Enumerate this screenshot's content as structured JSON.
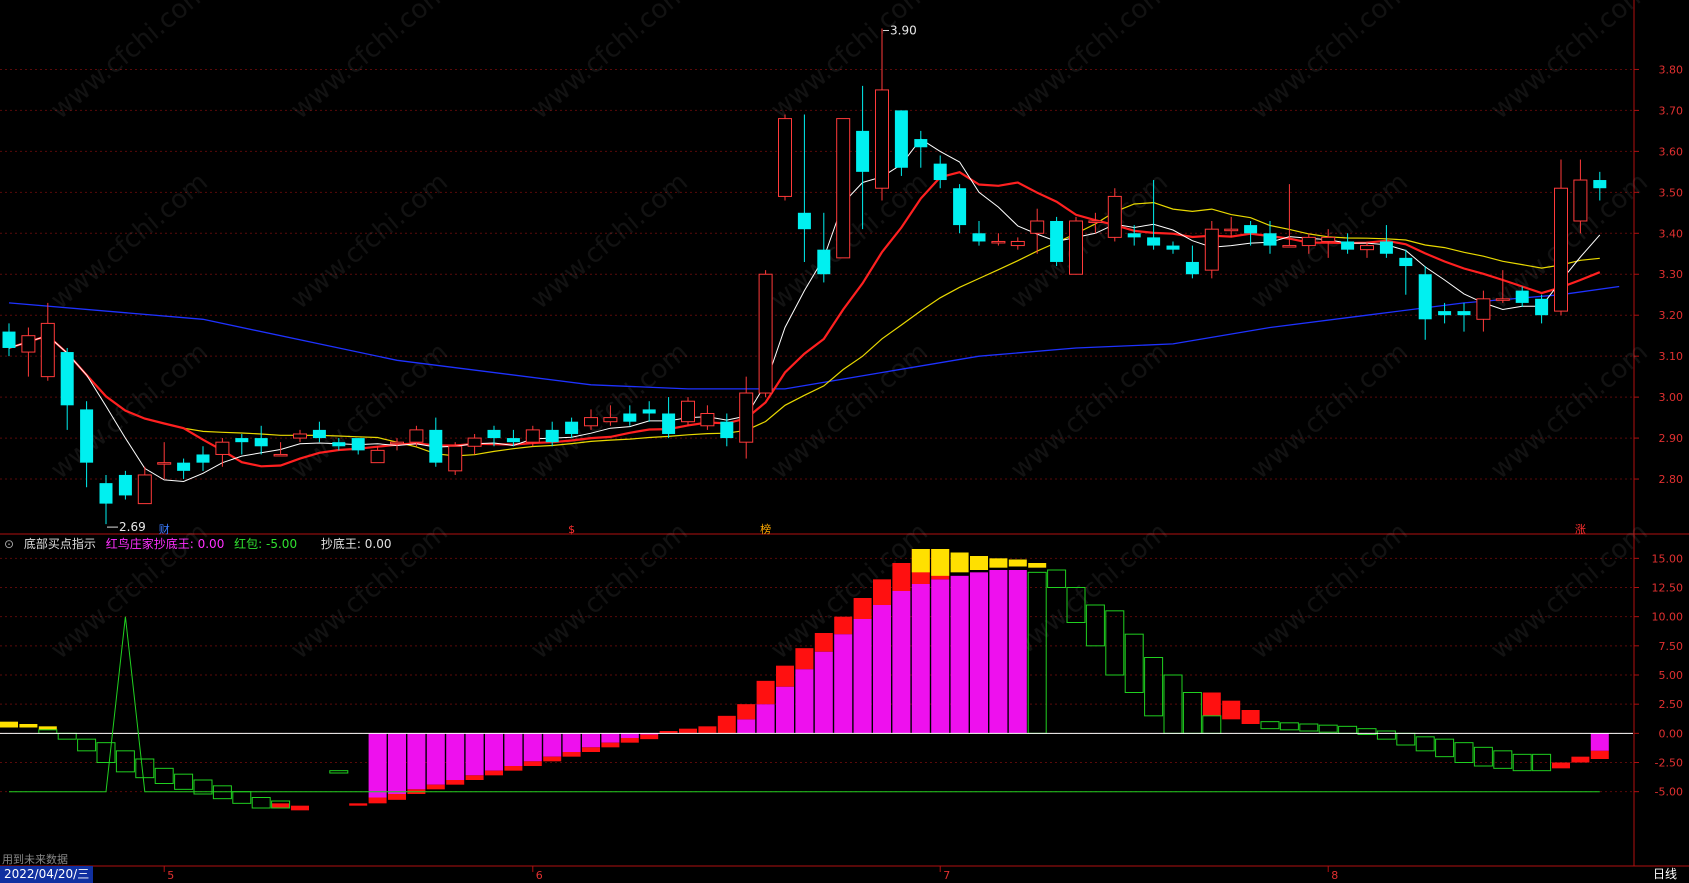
{
  "chart_data": [
    {
      "type": "candlestick",
      "title": "",
      "ylim": [
        2.7,
        3.95
      ],
      "y_ticks": [
        "3.80",
        "3.70",
        "3.60",
        "3.50",
        "3.40",
        "3.30",
        "3.20",
        "3.10",
        "3.00",
        "2.90",
        "2.80"
      ],
      "annotations": {
        "high": "3.90",
        "low": "2.69"
      },
      "event_markers": [
        {
          "index": 8,
          "label": "财",
          "color": "#3a7bff"
        },
        {
          "index": 29,
          "label": "$",
          "color": "#ff3030"
        },
        {
          "index": 39,
          "label": "榜",
          "color": "#ffaa00"
        },
        {
          "index": 81,
          "label": "涨",
          "color": "#ff3030"
        }
      ],
      "candles": [
        [
          3.16,
          3.12,
          3.18,
          3.1
        ],
        [
          3.11,
          3.15,
          3.17,
          3.05
        ],
        [
          3.05,
          3.18,
          3.23,
          3.04
        ],
        [
          3.11,
          2.98,
          3.12,
          2.92
        ],
        [
          2.97,
          2.84,
          2.99,
          2.78
        ],
        [
          2.79,
          2.74,
          2.81,
          2.69
        ],
        [
          2.81,
          2.76,
          2.82,
          2.75
        ],
        [
          2.74,
          2.81,
          2.83,
          2.74
        ],
        [
          2.84,
          2.84,
          2.89,
          2.8
        ],
        [
          2.84,
          2.82,
          2.85,
          2.8
        ],
        [
          2.86,
          2.84,
          2.88,
          2.82
        ],
        [
          2.86,
          2.89,
          2.9,
          2.83
        ],
        [
          2.9,
          2.89,
          2.91,
          2.86
        ],
        [
          2.9,
          2.88,
          2.93,
          2.86
        ],
        [
          2.86,
          2.86,
          2.89,
          2.86
        ],
        [
          2.9,
          2.91,
          2.92,
          2.89
        ],
        [
          2.92,
          2.9,
          2.94,
          2.89
        ],
        [
          2.89,
          2.88,
          2.9,
          2.87
        ],
        [
          2.9,
          2.87,
          2.9,
          2.86
        ],
        [
          2.84,
          2.87,
          2.88,
          2.84
        ],
        [
          2.89,
          2.89,
          2.9,
          2.87
        ],
        [
          2.89,
          2.92,
          2.93,
          2.88
        ],
        [
          2.92,
          2.84,
          2.95,
          2.83
        ],
        [
          2.82,
          2.88,
          2.89,
          2.81
        ],
        [
          2.88,
          2.9,
          2.91,
          2.86
        ],
        [
          2.92,
          2.9,
          2.93,
          2.88
        ],
        [
          2.9,
          2.89,
          2.92,
          2.88
        ],
        [
          2.89,
          2.92,
          2.93,
          2.88
        ],
        [
          2.92,
          2.89,
          2.94,
          2.88
        ],
        [
          2.94,
          2.91,
          2.95,
          2.9
        ],
        [
          2.93,
          2.95,
          2.97,
          2.92
        ],
        [
          2.94,
          2.95,
          2.98,
          2.93
        ],
        [
          2.96,
          2.94,
          2.98,
          2.93
        ],
        [
          2.97,
          2.96,
          2.99,
          2.94
        ],
        [
          2.96,
          2.91,
          3.0,
          2.9
        ],
        [
          2.94,
          2.99,
          3.0,
          2.93
        ],
        [
          2.93,
          2.96,
          2.98,
          2.92
        ],
        [
          2.94,
          2.9,
          2.96,
          2.88
        ],
        [
          2.89,
          3.01,
          3.05,
          2.85
        ],
        [
          3.01,
          3.3,
          3.31,
          3.0
        ],
        [
          3.49,
          3.68,
          3.69,
          3.48
        ],
        [
          3.45,
          3.41,
          3.69,
          3.33
        ],
        [
          3.36,
          3.3,
          3.45,
          3.28
        ],
        [
          3.34,
          3.68,
          3.68,
          3.34
        ],
        [
          3.65,
          3.55,
          3.76,
          3.41
        ],
        [
          3.51,
          3.75,
          3.9,
          3.48
        ],
        [
          3.7,
          3.56,
          3.7,
          3.54
        ],
        [
          3.63,
          3.61,
          3.65,
          3.56
        ],
        [
          3.57,
          3.53,
          3.59,
          3.51
        ],
        [
          3.51,
          3.42,
          3.52,
          3.4
        ],
        [
          3.4,
          3.38,
          3.43,
          3.37
        ],
        [
          3.38,
          3.38,
          3.4,
          3.37
        ],
        [
          3.37,
          3.38,
          3.39,
          3.36
        ],
        [
          3.4,
          3.43,
          3.46,
          3.35
        ],
        [
          3.43,
          3.33,
          3.44,
          3.32
        ],
        [
          3.3,
          3.43,
          3.44,
          3.3
        ],
        [
          3.43,
          3.43,
          3.45,
          3.4
        ],
        [
          3.39,
          3.49,
          3.51,
          3.38
        ],
        [
          3.4,
          3.39,
          3.42,
          3.37
        ],
        [
          3.39,
          3.37,
          3.53,
          3.36
        ],
        [
          3.37,
          3.36,
          3.38,
          3.35
        ],
        [
          3.33,
          3.3,
          3.37,
          3.29
        ],
        [
          3.31,
          3.41,
          3.43,
          3.29
        ],
        [
          3.41,
          3.41,
          3.44,
          3.39
        ],
        [
          3.42,
          3.4,
          3.43,
          3.37
        ],
        [
          3.4,
          3.37,
          3.43,
          3.35
        ],
        [
          3.37,
          3.37,
          3.52,
          3.37
        ],
        [
          3.37,
          3.39,
          3.4,
          3.35
        ],
        [
          3.38,
          3.39,
          3.41,
          3.34
        ],
        [
          3.38,
          3.36,
          3.4,
          3.35
        ],
        [
          3.36,
          3.37,
          3.38,
          3.34
        ],
        [
          3.38,
          3.35,
          3.42,
          3.34
        ],
        [
          3.34,
          3.32,
          3.36,
          3.25
        ],
        [
          3.3,
          3.19,
          3.32,
          3.14
        ],
        [
          3.21,
          3.2,
          3.23,
          3.18
        ],
        [
          3.21,
          3.2,
          3.23,
          3.16
        ],
        [
          3.19,
          3.24,
          3.26,
          3.16
        ],
        [
          3.24,
          3.24,
          3.31,
          3.23
        ],
        [
          3.26,
          3.23,
          3.27,
          3.22
        ],
        [
          3.24,
          3.2,
          3.25,
          3.18
        ],
        [
          3.21,
          3.51,
          3.58,
          3.2
        ],
        [
          3.43,
          3.53,
          3.58,
          3.4
        ],
        [
          3.53,
          3.51,
          3.55,
          3.48
        ]
      ],
      "ma_colors": {
        "ma5": "#ffffff",
        "ma10": "#ff2020",
        "ma20": "#e8d800",
        "ma60": "#1e32ff"
      },
      "ma60": [
        [
          0,
          3.23
        ],
        [
          10,
          3.19
        ],
        [
          20,
          3.09
        ],
        [
          30,
          3.03
        ],
        [
          35,
          3.02
        ],
        [
          40,
          3.02
        ],
        [
          45,
          3.06
        ],
        [
          50,
          3.1
        ],
        [
          55,
          3.12
        ],
        [
          60,
          3.13
        ],
        [
          65,
          3.17
        ],
        [
          70,
          3.2
        ],
        [
          75,
          3.23
        ],
        [
          80,
          3.25
        ],
        [
          83,
          3.27
        ]
      ]
    },
    {
      "type": "indicator",
      "title": "底部买点指示",
      "series_labels": [
        {
          "label": "红鸟庄家抄底王:",
          "value": "0.00",
          "color": "#ff30ff"
        },
        {
          "label": "红包:",
          "value": "-5.00",
          "color": "#30e030"
        },
        {
          "label": "抄底王:",
          "value": "0.00",
          "color": "#e0e0e0"
        }
      ],
      "ylim": [
        -10,
        17
      ],
      "y_ticks": [
        "15.00",
        "12.50",
        "10.00",
        "7.50",
        "5.00",
        "2.50",
        "0.00",
        "-2.50",
        "-5.00"
      ],
      "green_boxes": [
        [
          2,
          0.0,
          0.3
        ],
        [
          3,
          -0.5,
          0.0
        ],
        [
          4,
          -1.5,
          -0.5
        ],
        [
          5,
          -2.5,
          -0.8
        ],
        [
          6,
          -3.3,
          -1.5
        ],
        [
          7,
          -3.8,
          -2.2
        ],
        [
          8,
          -4.3,
          -3.0
        ],
        [
          9,
          -4.8,
          -3.5
        ],
        [
          10,
          -5.2,
          -4.0
        ],
        [
          11,
          -5.6,
          -4.5
        ],
        [
          12,
          -6.0,
          -5.0
        ],
        [
          13,
          -6.4,
          -5.5
        ],
        [
          14,
          -6.4,
          -5.8
        ],
        [
          17,
          -3.4,
          -3.2
        ],
        [
          53,
          0.0,
          13.8
        ],
        [
          54,
          12.5,
          14.0
        ],
        [
          55,
          9.5,
          12.5
        ],
        [
          56,
          7.5,
          11.0
        ],
        [
          57,
          5.0,
          10.5
        ],
        [
          58,
          3.5,
          8.5
        ],
        [
          59,
          1.5,
          6.5
        ],
        [
          60,
          0.0,
          5.0
        ],
        [
          61,
          0.0,
          3.5
        ],
        [
          62,
          0.0,
          1.5
        ],
        [
          65,
          0.4,
          1.0
        ],
        [
          66,
          0.3,
          0.9
        ],
        [
          67,
          0.2,
          0.8
        ],
        [
          68,
          0.1,
          0.7
        ],
        [
          69,
          0.0,
          0.6
        ],
        [
          70,
          -0.1,
          0.4
        ],
        [
          71,
          -0.5,
          0.2
        ],
        [
          72,
          -1.0,
          0.0
        ],
        [
          73,
          -1.5,
          -0.3
        ],
        [
          74,
          -2.0,
          -0.5
        ],
        [
          75,
          -2.5,
          -0.8
        ],
        [
          76,
          -2.8,
          -1.2
        ],
        [
          77,
          -3.0,
          -1.5
        ],
        [
          78,
          -3.2,
          -1.8
        ],
        [
          79,
          -3.2,
          -1.8
        ]
      ],
      "magenta_bars": [
        [
          19,
          -5.5
        ],
        [
          20,
          -5.2
        ],
        [
          21,
          -4.8
        ],
        [
          22,
          -4.4
        ],
        [
          23,
          -4.0
        ],
        [
          24,
          -3.6
        ],
        [
          25,
          -3.2
        ],
        [
          26,
          -2.8
        ],
        [
          27,
          -2.4
        ],
        [
          28,
          -2.0
        ],
        [
          29,
          -1.6
        ],
        [
          30,
          -1.2
        ],
        [
          31,
          -0.8
        ],
        [
          32,
          -0.4
        ],
        [
          33,
          -0.1
        ],
        [
          38,
          1.2
        ],
        [
          39,
          2.5
        ],
        [
          40,
          4.0
        ],
        [
          41,
          5.5
        ],
        [
          42,
          7.0
        ],
        [
          43,
          8.5
        ],
        [
          44,
          9.8
        ],
        [
          45,
          11.0
        ],
        [
          46,
          12.2
        ],
        [
          47,
          12.8
        ],
        [
          48,
          13.2
        ],
        [
          49,
          13.5
        ],
        [
          50,
          13.8
        ],
        [
          51,
          14.0
        ],
        [
          52,
          14.0
        ],
        [
          82,
          -1.5
        ]
      ],
      "red_bars": [
        [
          14,
          -6.0,
          -6.4
        ],
        [
          15,
          -6.2,
          -6.6
        ],
        [
          18,
          -6.0,
          -6.2
        ],
        [
          19,
          -5.5,
          -6.0
        ],
        [
          20,
          -5.2,
          -5.7
        ],
        [
          21,
          -4.8,
          -5.2
        ],
        [
          22,
          -4.4,
          -4.8
        ],
        [
          23,
          -4.0,
          -4.4
        ],
        [
          24,
          -3.6,
          -4.0
        ],
        [
          25,
          -3.2,
          -3.6
        ],
        [
          26,
          -2.8,
          -3.2
        ],
        [
          27,
          -2.4,
          -2.8
        ],
        [
          28,
          -2.0,
          -2.4
        ],
        [
          29,
          -1.6,
          -2.0
        ],
        [
          30,
          -1.2,
          -1.6
        ],
        [
          31,
          -0.8,
          -1.2
        ],
        [
          32,
          -0.4,
          -0.8
        ],
        [
          33,
          -0.1,
          -0.5
        ],
        [
          34,
          0.0,
          0.2
        ],
        [
          35,
          0.0,
          0.4
        ],
        [
          36,
          0.0,
          0.6
        ],
        [
          37,
          0.0,
          1.5
        ],
        [
          38,
          1.2,
          2.5
        ],
        [
          39,
          2.5,
          4.5
        ],
        [
          40,
          4.0,
          5.8
        ],
        [
          41,
          5.5,
          7.3
        ],
        [
          42,
          7.0,
          8.6
        ],
        [
          43,
          8.5,
          10.0
        ],
        [
          44,
          9.8,
          11.6
        ],
        [
          45,
          11.0,
          13.2
        ],
        [
          46,
          12.2,
          14.6
        ],
        [
          47,
          12.8,
          15.8
        ],
        [
          48,
          13.2,
          15.8
        ],
        [
          62,
          1.5,
          3.5
        ],
        [
          63,
          1.2,
          2.8
        ],
        [
          64,
          0.8,
          2.0
        ],
        [
          80,
          -3.0,
          -2.5
        ],
        [
          81,
          -2.5,
          -2.0
        ],
        [
          82,
          -2.2,
          -1.5
        ]
      ],
      "yellow_bars": [
        [
          0,
          0.5,
          1.0
        ],
        [
          1,
          0.5,
          0.8
        ],
        [
          2,
          0.3,
          0.6
        ],
        [
          47,
          13.8,
          15.8
        ],
        [
          48,
          13.5,
          15.8
        ],
        [
          49,
          13.8,
          15.5
        ],
        [
          50,
          14.0,
          15.2
        ],
        [
          51,
          14.2,
          15.0
        ],
        [
          52,
          14.3,
          14.9
        ],
        [
          53,
          14.2,
          14.6
        ]
      ],
      "green_line": [
        [
          0,
          -5
        ],
        [
          5,
          -5
        ],
        [
          6,
          10
        ],
        [
          7,
          -5
        ],
        [
          82,
          -5
        ]
      ]
    }
  ],
  "watermark": "www.cfchi.com",
  "x_axis": {
    "months": [
      {
        "index": 8,
        "label": "5"
      },
      {
        "index": 27,
        "label": "6"
      },
      {
        "index": 48,
        "label": "7"
      },
      {
        "index": 68,
        "label": "8"
      }
    ]
  },
  "date_label": "2022/04/20/三",
  "period_label": "日线",
  "future_note": "用到未来数据"
}
